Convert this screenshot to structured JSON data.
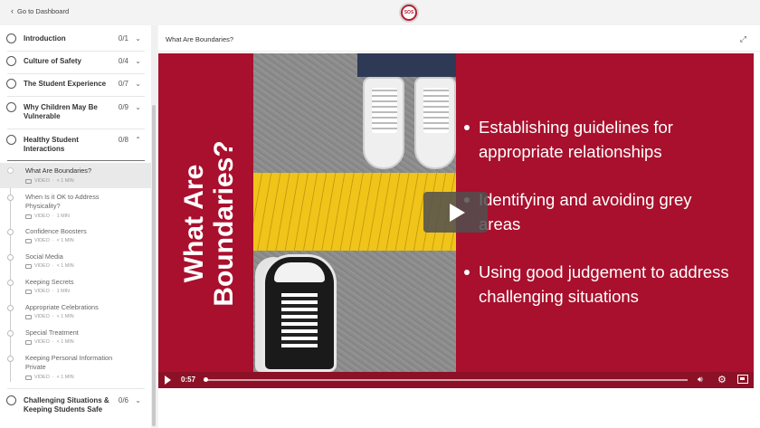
{
  "header": {
    "back_label": "Go to Dashboard",
    "logo_text": "SOS"
  },
  "modules": [
    {
      "title": "Introduction",
      "count": "0/1"
    },
    {
      "title": "Culture of Safety",
      "count": "0/4"
    },
    {
      "title": "The Student Experience",
      "count": "0/7"
    },
    {
      "title": "Why Children May Be Vulnerable",
      "count": "0/9"
    },
    {
      "title": "Healthy Student Interactions",
      "count": "0/8"
    },
    {
      "title": "Challenging Situations & Keeping Students Safe",
      "count": "0/6"
    }
  ],
  "lessons": [
    {
      "title": "What Are Boundaries?",
      "type": "VIDEO",
      "duration": "< 1 MIN"
    },
    {
      "title": "When Is it OK to Address Physicality?",
      "type": "VIDEO",
      "duration": "1 MIN"
    },
    {
      "title": "Confidence Boosters",
      "type": "VIDEO",
      "duration": "< 1 MIN"
    },
    {
      "title": "Social Media",
      "type": "VIDEO",
      "duration": "< 1 MIN"
    },
    {
      "title": "Keeping Secrets",
      "type": "VIDEO",
      "duration": "1 MIN"
    },
    {
      "title": "Appropriate Celebrations",
      "type": "VIDEO",
      "duration": "< 1 MIN"
    },
    {
      "title": "Special Treatment",
      "type": "VIDEO",
      "duration": "< 1 MIN"
    },
    {
      "title": "Keeping Personal Information Private",
      "type": "VIDEO",
      "duration": "< 1 MIN"
    }
  ],
  "main": {
    "title": "What Are Boundaries?"
  },
  "video": {
    "slide_title_line1": "What Are",
    "slide_title_line2": "Boundaries?",
    "bullets": [
      "Establishing guidelines for appropriate relationships",
      "Identifying and avoiding grey areas",
      "Using good judgement to address challenging situations"
    ],
    "time": "0:57",
    "progress": 0
  },
  "colors": {
    "accent": "#a8102d",
    "highlight_line": "#f0c419"
  }
}
